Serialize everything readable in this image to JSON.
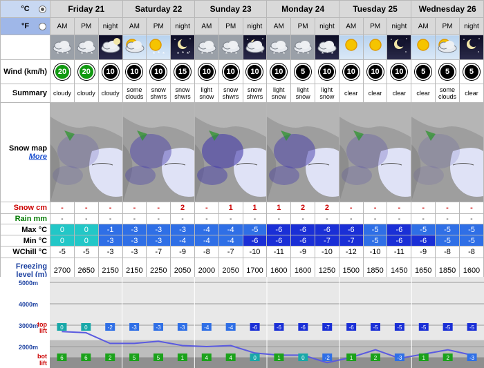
{
  "units": {
    "celsius": "°C",
    "fahrenheit": "°F",
    "selected": "C"
  },
  "days": [
    "Friday 21",
    "Saturday 22",
    "Sunday 23",
    "Monday 24",
    "Tuesday 25",
    "Wednesday 26"
  ],
  "periods": [
    "AM",
    "PM",
    "night",
    "AM",
    "PM",
    "night",
    "AM",
    "PM",
    "night",
    "AM",
    "PM",
    "night",
    "AM",
    "PM",
    "night",
    "AM",
    "PM",
    "night"
  ],
  "weather_icons": [
    "cloud-snow-icon",
    "cloud-snow-icon",
    "cloud-moon-icon",
    "sun-cloud-icon",
    "sun-snow-icon",
    "moon-snow-icon",
    "cloud-snow-icon",
    "cloud-snow-icon",
    "moon-cloud-icon",
    "cloud-snow-icon",
    "cloud-snow-icon",
    "cloud-snow-icon",
    "sun-icon",
    "sun-icon",
    "moon-icon",
    "sun-icon",
    "sun-cloud-icon",
    "moon-icon"
  ],
  "labels": {
    "wind": "Wind (km/h)",
    "summary": "Summary",
    "snow_map": "Snow map",
    "more": "More",
    "snow": "Snow cm",
    "rain": "Rain mm",
    "max": "Max °C",
    "min": "Min °C",
    "wchill": "WChill °C",
    "freezing_1": "Freezing",
    "freezing_2": "level (m)"
  },
  "wind": [
    {
      "v": "20",
      "d": "N",
      "c": "#119911"
    },
    {
      "v": "20",
      "d": "N",
      "c": "#119911"
    },
    {
      "v": "10",
      "d": "NW",
      "c": "#000"
    },
    {
      "v": "10",
      "d": "NW",
      "c": "#000"
    },
    {
      "v": "10",
      "d": "NW",
      "c": "#000"
    },
    {
      "v": "15",
      "d": "NW",
      "c": "#000"
    },
    {
      "v": "10",
      "d": "N",
      "c": "#000"
    },
    {
      "v": "10",
      "d": "S",
      "c": "#000"
    },
    {
      "v": "10",
      "d": "N",
      "c": "#000"
    },
    {
      "v": "10",
      "d": "N",
      "c": "#000"
    },
    {
      "v": "5",
      "d": "NW",
      "c": "#000"
    },
    {
      "v": "10",
      "d": "N",
      "c": "#000"
    },
    {
      "v": "10",
      "d": "N",
      "c": "#000"
    },
    {
      "v": "10",
      "d": "NW",
      "c": "#000"
    },
    {
      "v": "10",
      "d": "NW",
      "c": "#000"
    },
    {
      "v": "5",
      "d": "E",
      "c": "#000"
    },
    {
      "v": "5",
      "d": "E",
      "c": "#000"
    },
    {
      "v": "5",
      "d": "SE",
      "c": "#000"
    }
  ],
  "summary": [
    [
      "cloudy"
    ],
    [
      "cloudy"
    ],
    [
      "cloudy"
    ],
    [
      "some",
      "clouds"
    ],
    [
      "snow",
      "shwrs"
    ],
    [
      "snow",
      "shwrs"
    ],
    [
      "light",
      "snow"
    ],
    [
      "snow",
      "shwrs"
    ],
    [
      "snow",
      "shwrs"
    ],
    [
      "light",
      "snow"
    ],
    [
      "light",
      "snow"
    ],
    [
      "light",
      "snow"
    ],
    [
      "clear"
    ],
    [
      "clear"
    ],
    [
      "clear"
    ],
    [
      "clear"
    ],
    [
      "some",
      "clouds"
    ],
    [
      "clear"
    ]
  ],
  "snow": [
    "-",
    "-",
    "-",
    "-",
    "-",
    "2",
    "-",
    "1",
    "1",
    "1",
    "2",
    "2",
    "-",
    "-",
    "-",
    "-",
    "-",
    "-"
  ],
  "rain": [
    "-",
    "-",
    "-",
    "-",
    "-",
    "-",
    "-",
    "-",
    "-",
    "-",
    "-",
    "-",
    "-",
    "-",
    "-",
    "-",
    "-",
    "-"
  ],
  "max": [
    "0",
    "0",
    "-1",
    "-3",
    "-3",
    "-3",
    "-4",
    "-4",
    "-5",
    "-6",
    "-6",
    "-6",
    "-6",
    "-5",
    "-6",
    "-5",
    "-5",
    "-5"
  ],
  "min": [
    "0",
    "0",
    "-3",
    "-3",
    "-3",
    "-4",
    "-4",
    "-4",
    "-6",
    "-6",
    "-6",
    "-7",
    "-7",
    "-5",
    "-6",
    "-6",
    "-5",
    "-5"
  ],
  "wchill": [
    "-5",
    "-5",
    "-3",
    "-3",
    "-7",
    "-9",
    "-8",
    "-7",
    "-10",
    "-11",
    "-9",
    "-10",
    "-12",
    "-10",
    "-11",
    "-9",
    "-8",
    "-8"
  ],
  "freezing": [
    "2700",
    "2650",
    "2150",
    "2150",
    "2250",
    "2050",
    "2000",
    "2050",
    "1700",
    "1600",
    "1600",
    "1250",
    "1500",
    "1850",
    "1450",
    "1650",
    "1850",
    "1600"
  ],
  "altitude_chart": {
    "y_labels": [
      "5000m",
      "4000m",
      "3000m",
      "2000m"
    ],
    "top_lift_label": [
      "top",
      "lift"
    ],
    "bot_lift_label": [
      "bot",
      "lift"
    ],
    "top_lift_temps": [
      "0",
      "0",
      "-2",
      "-3",
      "-3",
      "-3",
      "-4",
      "-4",
      "-6",
      "-6",
      "-6",
      "-7",
      "-6",
      "-5",
      "-5",
      "-5",
      "-5",
      "-5"
    ],
    "bot_lift_temps": [
      "6",
      "6",
      "2",
      "5",
      "5",
      "1",
      "4",
      "4",
      "0",
      "1",
      "0",
      "-2",
      "1",
      "2",
      "-3",
      "1",
      "2",
      "-3"
    ]
  }
}
